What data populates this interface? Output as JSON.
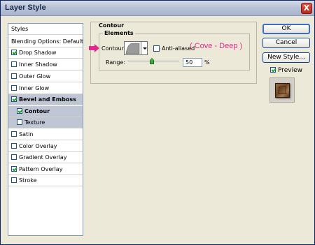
{
  "window": {
    "title": "Layer Style",
    "close_symbol": "X"
  },
  "sidebar": {
    "items": [
      {
        "label": "Styles",
        "checkbox": false
      },
      {
        "label": "Blending Options: Default",
        "checkbox": false
      },
      {
        "label": "Drop Shadow",
        "checkbox": true,
        "checked": true
      },
      {
        "label": "Inner Shadow",
        "checkbox": true,
        "checked": false
      },
      {
        "label": "Outer Glow",
        "checkbox": true,
        "checked": false
      },
      {
        "label": "Inner Glow",
        "checkbox": true,
        "checked": false
      },
      {
        "label": "Bevel and Emboss",
        "checkbox": true,
        "checked": true
      },
      {
        "label": "Contour",
        "checkbox": true,
        "checked": true
      },
      {
        "label": "Texture",
        "checkbox": true,
        "checked": false
      },
      {
        "label": "Satin",
        "checkbox": true,
        "checked": false
      },
      {
        "label": "Color Overlay",
        "checkbox": true,
        "checked": false
      },
      {
        "label": "Gradient Overlay",
        "checkbox": true,
        "checked": false
      },
      {
        "label": "Pattern Overlay",
        "checkbox": true,
        "checked": true
      },
      {
        "label": "Stroke",
        "checkbox": true,
        "checked": false
      }
    ]
  },
  "panel": {
    "title": "Contour",
    "group_title": "Elements",
    "contour_label": "Contour:",
    "anti_aliased_label": "Anti-aliased",
    "anti_aliased_checked": false,
    "annotation": "( Cove - Deep )",
    "range_label": "Range:",
    "range_value": "50",
    "range_unit": "%",
    "range_fraction": 0.5
  },
  "buttons": {
    "ok": "OK",
    "cancel": "Cancel",
    "new_style": "New Style...",
    "preview_label": "Preview",
    "preview_checked": true
  },
  "colors": {
    "annotation": "#e0298b",
    "arrow": "#e0298b",
    "selected_row": "#bfc6d6",
    "check": "#21a121"
  }
}
